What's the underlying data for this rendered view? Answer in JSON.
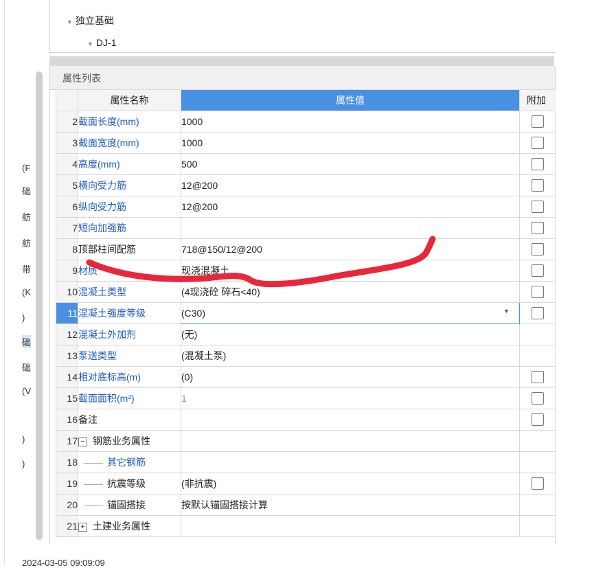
{
  "left_labels": [
    "(F",
    "础",
    "舫",
    "舫",
    "带",
    "(K",
    ")",
    "础",
    "础",
    "(V",
    ")",
    ")"
  ],
  "tree": {
    "node1": "独立基础",
    "node2": "DJ-1"
  },
  "panel_title": "属性列表",
  "columns": {
    "name": "属性名称",
    "value": "属性值",
    "extra": "附加"
  },
  "rows": [
    {
      "num": "2",
      "name": "截面长度(mm)",
      "value": "1000"
    },
    {
      "num": "3",
      "name": "截面宽度(mm)",
      "value": "1000"
    },
    {
      "num": "4",
      "name": "高度(mm)",
      "value": "500"
    },
    {
      "num": "5",
      "name": "横向受力筋",
      "value": "⁣12@200"
    },
    {
      "num": "6",
      "name": "纵向受力筋",
      "value": "⁣12@200"
    },
    {
      "num": "7",
      "name": "短向加强筋",
      "value": ""
    },
    {
      "num": "8",
      "name": "顶部柱间配筋",
      "value": "7⁣18@150/⁣12@200"
    },
    {
      "num": "9",
      "name": "材质",
      "value": "现浇混凝土"
    },
    {
      "num": "10",
      "name": "混凝土类型",
      "value": "(4现浇砼 碎石<40)"
    },
    {
      "num": "11",
      "name": "混凝土强度等级",
      "value": "(C30)"
    },
    {
      "num": "12",
      "name": "混凝土外加剂",
      "value": "(无)"
    },
    {
      "num": "13",
      "name": "泵送类型",
      "value": "(混凝土泵)"
    },
    {
      "num": "14",
      "name": "相对底标高(m)",
      "value": "(0)"
    },
    {
      "num": "15",
      "name": "截面面积(m²)",
      "value": "1"
    },
    {
      "num": "16",
      "name": "备注",
      "value": ""
    },
    {
      "num": "17",
      "name": "钢筋业务属性",
      "value": ""
    },
    {
      "num": "18",
      "name": "其它钢筋",
      "value": ""
    },
    {
      "num": "19",
      "name": "抗震等级",
      "value": "(非抗震)"
    },
    {
      "num": "20",
      "name": "锚固搭接",
      "value": "按默认锚固搭接计算"
    },
    {
      "num": "21",
      "name": "土建业务属性",
      "value": ""
    }
  ],
  "footer": "2024-03-05 09:09:09"
}
